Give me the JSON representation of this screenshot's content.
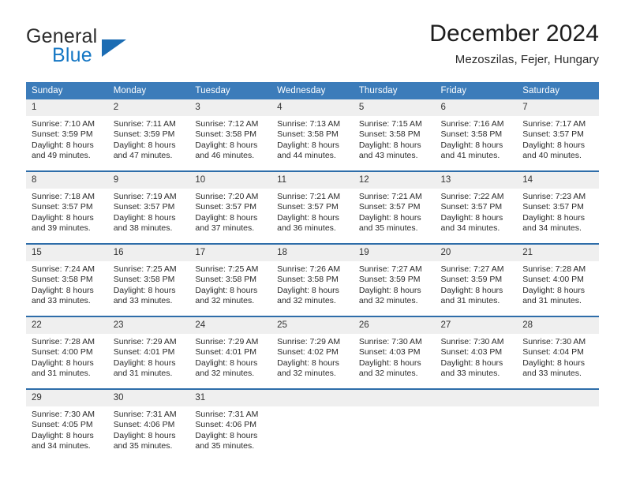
{
  "brand": {
    "name_part1": "General",
    "name_part2": "Blue",
    "accent_color": "#1577c4",
    "triangle_color": "#1b6cb3"
  },
  "header": {
    "title": "December 2024",
    "subtitle": "Mezoszilas, Fejer, Hungary"
  },
  "theme": {
    "header_bg": "#3c7cba",
    "row_divider": "#2e6da9",
    "daynum_bg": "#efefef"
  },
  "weekdays": [
    "Sunday",
    "Monday",
    "Tuesday",
    "Wednesday",
    "Thursday",
    "Friday",
    "Saturday"
  ],
  "labels": {
    "sunrise_prefix": "Sunrise:",
    "sunset_prefix": "Sunset:",
    "daylight_prefix": "Daylight:"
  },
  "weeks": [
    [
      {
        "day": "1",
        "sunrise": "Sunrise: 7:10 AM",
        "sunset": "Sunset: 3:59 PM",
        "daylight1": "Daylight: 8 hours",
        "daylight2": "and 49 minutes."
      },
      {
        "day": "2",
        "sunrise": "Sunrise: 7:11 AM",
        "sunset": "Sunset: 3:59 PM",
        "daylight1": "Daylight: 8 hours",
        "daylight2": "and 47 minutes."
      },
      {
        "day": "3",
        "sunrise": "Sunrise: 7:12 AM",
        "sunset": "Sunset: 3:58 PM",
        "daylight1": "Daylight: 8 hours",
        "daylight2": "and 46 minutes."
      },
      {
        "day": "4",
        "sunrise": "Sunrise: 7:13 AM",
        "sunset": "Sunset: 3:58 PM",
        "daylight1": "Daylight: 8 hours",
        "daylight2": "and 44 minutes."
      },
      {
        "day": "5",
        "sunrise": "Sunrise: 7:15 AM",
        "sunset": "Sunset: 3:58 PM",
        "daylight1": "Daylight: 8 hours",
        "daylight2": "and 43 minutes."
      },
      {
        "day": "6",
        "sunrise": "Sunrise: 7:16 AM",
        "sunset": "Sunset: 3:58 PM",
        "daylight1": "Daylight: 8 hours",
        "daylight2": "and 41 minutes."
      },
      {
        "day": "7",
        "sunrise": "Sunrise: 7:17 AM",
        "sunset": "Sunset: 3:57 PM",
        "daylight1": "Daylight: 8 hours",
        "daylight2": "and 40 minutes."
      }
    ],
    [
      {
        "day": "8",
        "sunrise": "Sunrise: 7:18 AM",
        "sunset": "Sunset: 3:57 PM",
        "daylight1": "Daylight: 8 hours",
        "daylight2": "and 39 minutes."
      },
      {
        "day": "9",
        "sunrise": "Sunrise: 7:19 AM",
        "sunset": "Sunset: 3:57 PM",
        "daylight1": "Daylight: 8 hours",
        "daylight2": "and 38 minutes."
      },
      {
        "day": "10",
        "sunrise": "Sunrise: 7:20 AM",
        "sunset": "Sunset: 3:57 PM",
        "daylight1": "Daylight: 8 hours",
        "daylight2": "and 37 minutes."
      },
      {
        "day": "11",
        "sunrise": "Sunrise: 7:21 AM",
        "sunset": "Sunset: 3:57 PM",
        "daylight1": "Daylight: 8 hours",
        "daylight2": "and 36 minutes."
      },
      {
        "day": "12",
        "sunrise": "Sunrise: 7:21 AM",
        "sunset": "Sunset: 3:57 PM",
        "daylight1": "Daylight: 8 hours",
        "daylight2": "and 35 minutes."
      },
      {
        "day": "13",
        "sunrise": "Sunrise: 7:22 AM",
        "sunset": "Sunset: 3:57 PM",
        "daylight1": "Daylight: 8 hours",
        "daylight2": "and 34 minutes."
      },
      {
        "day": "14",
        "sunrise": "Sunrise: 7:23 AM",
        "sunset": "Sunset: 3:57 PM",
        "daylight1": "Daylight: 8 hours",
        "daylight2": "and 34 minutes."
      }
    ],
    [
      {
        "day": "15",
        "sunrise": "Sunrise: 7:24 AM",
        "sunset": "Sunset: 3:58 PM",
        "daylight1": "Daylight: 8 hours",
        "daylight2": "and 33 minutes."
      },
      {
        "day": "16",
        "sunrise": "Sunrise: 7:25 AM",
        "sunset": "Sunset: 3:58 PM",
        "daylight1": "Daylight: 8 hours",
        "daylight2": "and 33 minutes."
      },
      {
        "day": "17",
        "sunrise": "Sunrise: 7:25 AM",
        "sunset": "Sunset: 3:58 PM",
        "daylight1": "Daylight: 8 hours",
        "daylight2": "and 32 minutes."
      },
      {
        "day": "18",
        "sunrise": "Sunrise: 7:26 AM",
        "sunset": "Sunset: 3:58 PM",
        "daylight1": "Daylight: 8 hours",
        "daylight2": "and 32 minutes."
      },
      {
        "day": "19",
        "sunrise": "Sunrise: 7:27 AM",
        "sunset": "Sunset: 3:59 PM",
        "daylight1": "Daylight: 8 hours",
        "daylight2": "and 32 minutes."
      },
      {
        "day": "20",
        "sunrise": "Sunrise: 7:27 AM",
        "sunset": "Sunset: 3:59 PM",
        "daylight1": "Daylight: 8 hours",
        "daylight2": "and 31 minutes."
      },
      {
        "day": "21",
        "sunrise": "Sunrise: 7:28 AM",
        "sunset": "Sunset: 4:00 PM",
        "daylight1": "Daylight: 8 hours",
        "daylight2": "and 31 minutes."
      }
    ],
    [
      {
        "day": "22",
        "sunrise": "Sunrise: 7:28 AM",
        "sunset": "Sunset: 4:00 PM",
        "daylight1": "Daylight: 8 hours",
        "daylight2": "and 31 minutes."
      },
      {
        "day": "23",
        "sunrise": "Sunrise: 7:29 AM",
        "sunset": "Sunset: 4:01 PM",
        "daylight1": "Daylight: 8 hours",
        "daylight2": "and 31 minutes."
      },
      {
        "day": "24",
        "sunrise": "Sunrise: 7:29 AM",
        "sunset": "Sunset: 4:01 PM",
        "daylight1": "Daylight: 8 hours",
        "daylight2": "and 32 minutes."
      },
      {
        "day": "25",
        "sunrise": "Sunrise: 7:29 AM",
        "sunset": "Sunset: 4:02 PM",
        "daylight1": "Daylight: 8 hours",
        "daylight2": "and 32 minutes."
      },
      {
        "day": "26",
        "sunrise": "Sunrise: 7:30 AM",
        "sunset": "Sunset: 4:03 PM",
        "daylight1": "Daylight: 8 hours",
        "daylight2": "and 32 minutes."
      },
      {
        "day": "27",
        "sunrise": "Sunrise: 7:30 AM",
        "sunset": "Sunset: 4:03 PM",
        "daylight1": "Daylight: 8 hours",
        "daylight2": "and 33 minutes."
      },
      {
        "day": "28",
        "sunrise": "Sunrise: 7:30 AM",
        "sunset": "Sunset: 4:04 PM",
        "daylight1": "Daylight: 8 hours",
        "daylight2": "and 33 minutes."
      }
    ],
    [
      {
        "day": "29",
        "sunrise": "Sunrise: 7:30 AM",
        "sunset": "Sunset: 4:05 PM",
        "daylight1": "Daylight: 8 hours",
        "daylight2": "and 34 minutes."
      },
      {
        "day": "30",
        "sunrise": "Sunrise: 7:31 AM",
        "sunset": "Sunset: 4:06 PM",
        "daylight1": "Daylight: 8 hours",
        "daylight2": "and 35 minutes."
      },
      {
        "day": "31",
        "sunrise": "Sunrise: 7:31 AM",
        "sunset": "Sunset: 4:06 PM",
        "daylight1": "Daylight: 8 hours",
        "daylight2": "and 35 minutes."
      },
      {
        "day": "",
        "sunrise": "",
        "sunset": "",
        "daylight1": "",
        "daylight2": ""
      },
      {
        "day": "",
        "sunrise": "",
        "sunset": "",
        "daylight1": "",
        "daylight2": ""
      },
      {
        "day": "",
        "sunrise": "",
        "sunset": "",
        "daylight1": "",
        "daylight2": ""
      },
      {
        "day": "",
        "sunrise": "",
        "sunset": "",
        "daylight1": "",
        "daylight2": ""
      }
    ]
  ]
}
